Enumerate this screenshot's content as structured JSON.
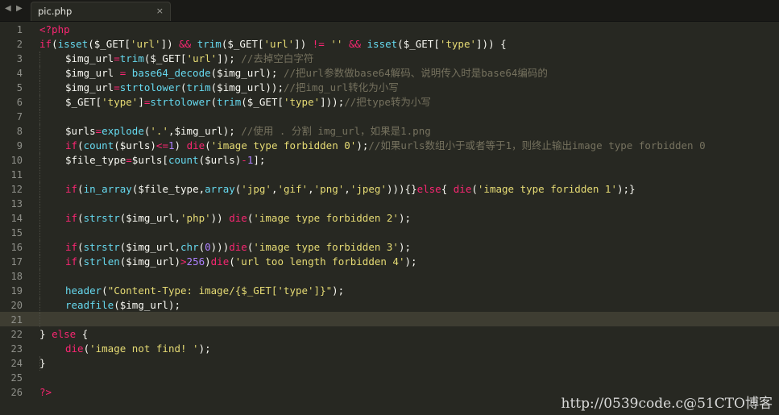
{
  "tabbar": {
    "nav_left": "◀",
    "nav_right": "▶",
    "tab_label": "pic.php",
    "tab_close": "×"
  },
  "editor": {
    "line_numbers": [
      "1",
      "2",
      "3",
      "4",
      "5",
      "6",
      "7",
      "8",
      "9",
      "10",
      "11",
      "12",
      "13",
      "14",
      "15",
      "16",
      "17",
      "18",
      "19",
      "20",
      "21",
      "22",
      "23",
      "24",
      "25",
      "26"
    ],
    "current_line": "21"
  },
  "watermark": "http://0539code.c@51CTO博客",
  "code": {
    "l1": [
      "<?php"
    ],
    "l2": [
      "if",
      "(",
      "isset",
      "($_GET[",
      "'url'",
      "]) ",
      "&&",
      " ",
      "trim",
      "($_GET[",
      "'url'",
      "]) ",
      "!=",
      " ",
      "''",
      " ",
      "&&",
      " ",
      "isset",
      "($_GET[",
      "'type'",
      "])) {"
    ],
    "l3": [
      "$img_url",
      "=",
      "trim",
      "($_GET[",
      "'url'",
      "]); ",
      "//去掉空白字符"
    ],
    "l4": [
      "$img_url ",
      "=",
      " ",
      "base64_decode",
      "($img_url); ",
      "//把url参数做base64解码、说明传入时是base64编码的"
    ],
    "l5": [
      "$img_url",
      "=",
      "strtolower",
      "(",
      "trim",
      "($img_url));",
      "//把img_url转化为小写"
    ],
    "l6": [
      "$_GET[",
      "'type'",
      "]",
      "=",
      "strtolower",
      "(",
      "trim",
      "($_GET[",
      "'type'",
      "]));",
      "//把type转为小写"
    ],
    "l8": [
      "$urls",
      "=",
      "explode",
      "(",
      "'.'",
      ",$img_url); ",
      "//使用 . 分割 img_url，如果是1.png"
    ],
    "l9": [
      "if",
      "(",
      "count",
      "($urls)",
      "<=",
      "1",
      ") ",
      "die",
      "(",
      "'image type forbidden 0'",
      ");",
      "//如果urls数组小于或者等于1，则终止输出image type forbidden 0"
    ],
    "l10": [
      "$file_type",
      "=",
      "$urls[",
      "count",
      "($urls)",
      "-",
      "1",
      "];"
    ],
    "l12": [
      "if",
      "(",
      "in_array",
      "($file_type,",
      "array",
      "(",
      "'jpg'",
      ",",
      "'gif'",
      ",",
      "'png'",
      ",",
      "'jpeg'",
      "))){}",
      "else",
      "{ ",
      "die",
      "(",
      "'image type foridden 1'",
      ");}"
    ],
    "l14": [
      "if",
      "(",
      "strstr",
      "($img_url,",
      "'php'",
      ")) ",
      "die",
      "(",
      "'image type forbidden 2'",
      ");"
    ],
    "l16": [
      "if",
      "(",
      "strstr",
      "($img_url,",
      "chr",
      "(",
      "0",
      ")))",
      "die",
      "(",
      "'image type forbidden 3'",
      ");"
    ],
    "l17": [
      "if",
      "(",
      "strlen",
      "($img_url)",
      ">",
      "256",
      ")",
      "die",
      "(",
      "'url too length forbidden 4'",
      ");"
    ],
    "l19": [
      "header",
      "(",
      "\"Content-Type: image/{$_GET['type']}\"",
      ");"
    ],
    "l20": [
      "readfile",
      "($img_url);"
    ],
    "l22": [
      "} ",
      "else",
      " {"
    ],
    "l23": [
      "die",
      "(",
      "'image not find! '",
      ");"
    ],
    "l24": [
      "}"
    ],
    "l26": [
      "?>"
    ]
  }
}
